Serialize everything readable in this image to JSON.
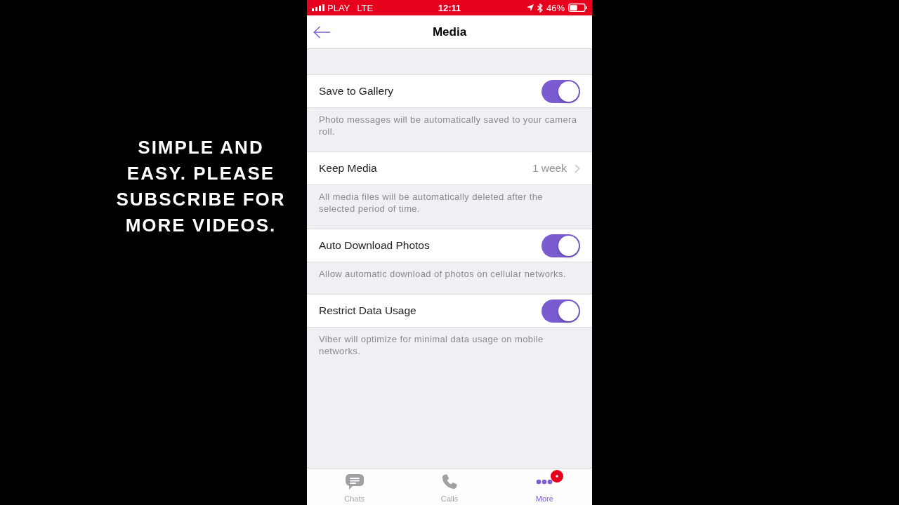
{
  "caption": "SIMPLE AND EASY. PLEASE SUBSCRIBE FOR MORE VIDEOS.",
  "status_bar": {
    "carrier": "PLAY",
    "network": "LTE",
    "time": "12:11",
    "battery": "46%"
  },
  "nav_bar": {
    "title": "Media"
  },
  "settings": [
    {
      "kind": "toggle",
      "label": "Save to Gallery",
      "on": true,
      "description": "Photo messages will be automatically saved to your camera roll."
    },
    {
      "kind": "disclosure",
      "label": "Keep Media",
      "value": "1 week",
      "description": "All media files will be automatically deleted after the selected period of time."
    },
    {
      "kind": "toggle",
      "label": "Auto Download Photos",
      "on": true,
      "description": "Allow automatic download of photos on cellular networks."
    },
    {
      "kind": "toggle",
      "label": "Restrict Data Usage",
      "on": true,
      "description": "Viber will optimize for minimal data usage on mobile networks."
    }
  ],
  "tab_bar": [
    {
      "label": "Chats",
      "selected": false,
      "badge": false
    },
    {
      "label": "Calls",
      "selected": false,
      "badge": false
    },
    {
      "label": "More",
      "selected": true,
      "badge": true
    }
  ]
}
